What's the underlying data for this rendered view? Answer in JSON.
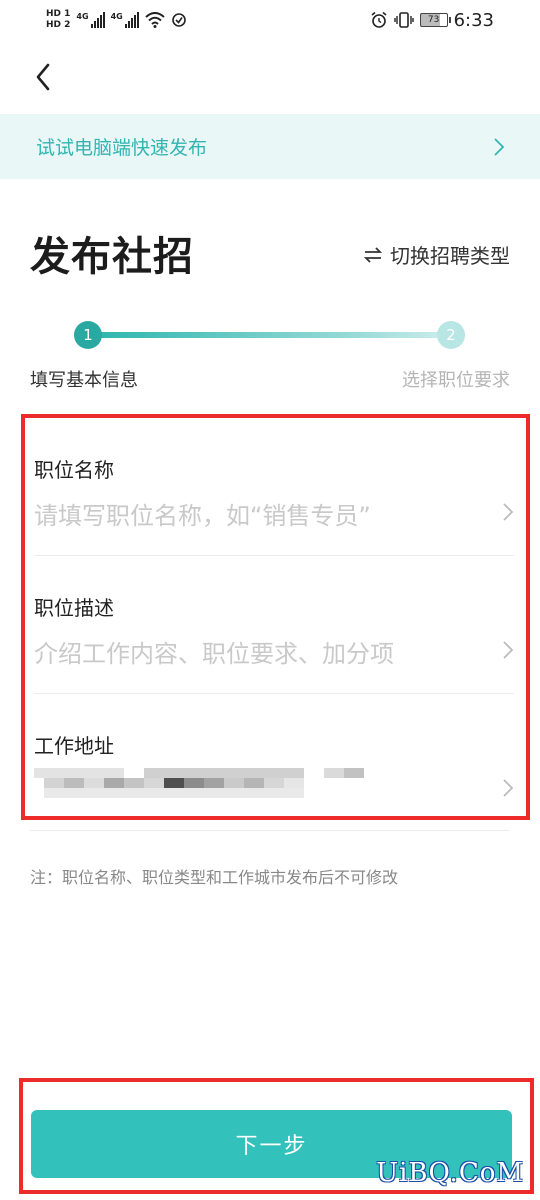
{
  "status_bar": {
    "hd_top": "HD",
    "hd_top_num": "1",
    "hd_bottom": "HD",
    "hd_bottom_num": "2",
    "net1": "4G",
    "net2": "4G",
    "battery": "73",
    "time": "6:33"
  },
  "banner": {
    "text": "试试电脑端快速发布"
  },
  "header": {
    "title": "发布社招",
    "switch_label": "切换招聘类型"
  },
  "stepper": {
    "step1_num": "1",
    "step1_label": "填写基本信息",
    "step2_num": "2",
    "step2_label": "选择职位要求"
  },
  "form": {
    "job_name_label": "职位名称",
    "job_name_placeholder": "请填写职位名称，如“销售专员”",
    "job_desc_label": "职位描述",
    "job_desc_placeholder": "介绍工作内容、职位要求、加分项",
    "address_label": "工作地址"
  },
  "note": "注：职位名称、职位类型和工作城市发布后不可修改",
  "next_button": "下一步",
  "watermark": "UiBQ.CoM",
  "colors": {
    "accent": "#33c2bb",
    "banner_bg": "#eaf7f7",
    "highlight": "#ee2b2b"
  }
}
